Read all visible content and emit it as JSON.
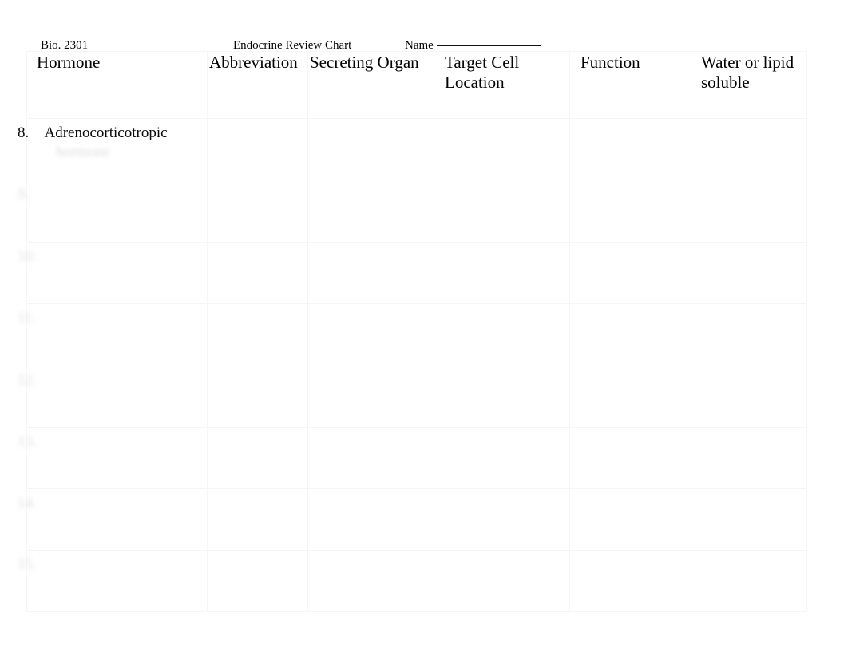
{
  "document": {
    "course": "Bio. 2301",
    "title": "Endocrine Review Chart",
    "name_label": "Name",
    "name_value": ""
  },
  "table": {
    "columns": [
      {
        "key": "hormone",
        "label": "Hormone"
      },
      {
        "key": "abbrev",
        "label": "Abbreviation"
      },
      {
        "key": "organ",
        "label": "Secreting Organ"
      },
      {
        "key": "target",
        "label": "Target Cell\nLocation"
      },
      {
        "key": "function",
        "label": "Function"
      },
      {
        "key": "soluble",
        "label": "Water or lipid\nsoluble"
      }
    ],
    "rows": [
      {
        "number": "8.",
        "hormone": "Adrenocorticotropic",
        "hormone_second_line": "hormone",
        "legible": true,
        "abbrev": "",
        "organ": "",
        "target": "",
        "function": "",
        "soluble": ""
      },
      {
        "number": "9.",
        "hormone": "",
        "hormone_second_line": "",
        "legible": false,
        "abbrev": "",
        "organ": "",
        "target": "",
        "function": "",
        "soluble": ""
      },
      {
        "number": "10.",
        "hormone": "",
        "hormone_second_line": "",
        "legible": false,
        "abbrev": "",
        "organ": "",
        "target": "",
        "function": "",
        "soluble": ""
      },
      {
        "number": "11.",
        "hormone": "",
        "hormone_second_line": "",
        "legible": false,
        "abbrev": "",
        "organ": "",
        "target": "",
        "function": "",
        "soluble": ""
      },
      {
        "number": "12.",
        "hormone": "",
        "hormone_second_line": "",
        "legible": false,
        "abbrev": "",
        "organ": "",
        "target": "",
        "function": "",
        "soluble": ""
      },
      {
        "number": "13.",
        "hormone": "",
        "hormone_second_line": "",
        "legible": false,
        "abbrev": "",
        "organ": "",
        "target": "",
        "function": "",
        "soluble": ""
      },
      {
        "number": "14.",
        "hormone": "",
        "hormone_second_line": "",
        "legible": false,
        "abbrev": "",
        "organ": "",
        "target": "",
        "function": "",
        "soluble": ""
      },
      {
        "number": "15.",
        "hormone": "",
        "hormone_second_line": "",
        "legible": false,
        "abbrev": "",
        "organ": "",
        "target": "",
        "function": "",
        "soluble": ""
      }
    ]
  },
  "style": {
    "ink": "#000000",
    "faded_ink": "#d9dadb",
    "grid_line": "#f4f7f8",
    "page_background": "#ffffff"
  }
}
